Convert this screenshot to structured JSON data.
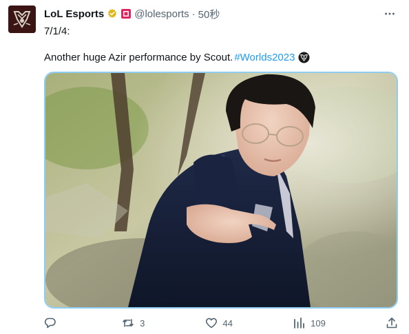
{
  "tweet": {
    "display_name": "LoL Esports",
    "handle": "@lolesports",
    "separator": "·",
    "time": "50秒",
    "line1": "7/1/4:",
    "line2_text": "Another huge Azir performance by Scout.",
    "hashtag": "#Worlds2023"
  },
  "actions": {
    "reply_count": "",
    "retweet_count": "3",
    "like_count": "44",
    "view_count": "109"
  },
  "colors": {
    "accent": "#1d9bf0",
    "verified_gold": "#e2b719",
    "affiliate_red": "#e0245e",
    "media_border": "#8ecdf3"
  },
  "icons": {
    "avatar": "worlds-trophy-logo",
    "verified": "verified-gold-badge",
    "affiliate": "affiliate-badge",
    "more": "more-icon",
    "reply": "reply-icon",
    "retweet": "retweet-icon",
    "like": "heart-icon",
    "views": "views-icon",
    "share": "share-icon"
  }
}
